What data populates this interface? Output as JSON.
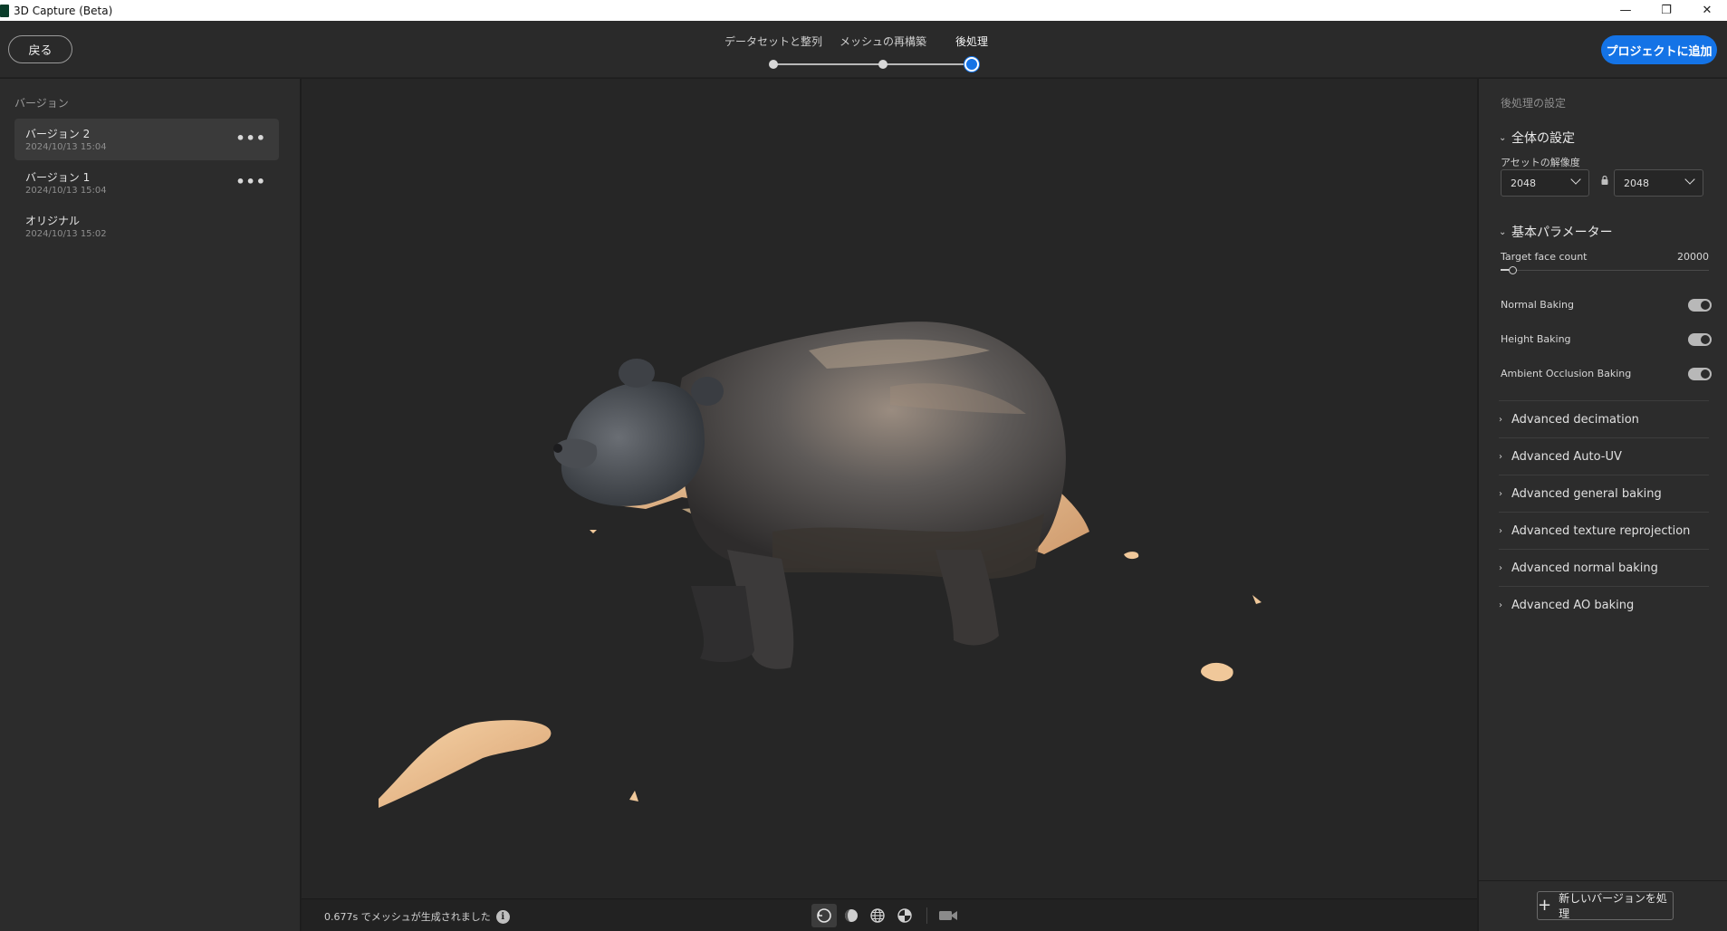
{
  "window": {
    "title": "3D Capture (Beta)",
    "minimize_glyph": "—",
    "restore_glyph": "❐",
    "close_glyph": "✕"
  },
  "header": {
    "back_label": "戻る",
    "steps": [
      {
        "label": "データセットと整列",
        "state": "done"
      },
      {
        "label": "メッシュの再構築",
        "state": "done"
      },
      {
        "label": "後処理",
        "state": "active"
      }
    ],
    "primary_label": "プロジェクトに追加"
  },
  "versions_panel": {
    "heading": "バージョン",
    "items": [
      {
        "name": "バージョン 2",
        "date": "2024/10/13 15:04",
        "more": "•••",
        "selected": true
      },
      {
        "name": "バージョン 1",
        "date": "2024/10/13 15:04",
        "more": "•••",
        "selected": false
      },
      {
        "name": "オリジナル",
        "date": "2024/10/13 15:02",
        "more": "",
        "selected": false
      }
    ]
  },
  "status_bar": {
    "message": "0.677s でメッシュが生成されました",
    "info_glyph": "i",
    "tools": [
      "orbit-icon",
      "shaded-sphere-icon",
      "wireframe-globe-icon",
      "texture-globe-icon",
      "camera-icon"
    ]
  },
  "settings": {
    "title": "後処理の設定",
    "global_section": "全体の設定",
    "resolution_label": "アセットの解像度",
    "resolution_width": "2048",
    "resolution_height": "2048",
    "params_section": "基本パラメーター",
    "target_face_label": "Target face count",
    "target_face_value": "20000",
    "target_face_fraction": 0.04,
    "toggles": [
      {
        "label": "Normal Baking",
        "on": true
      },
      {
        "label": "Height Baking",
        "on": true
      },
      {
        "label": "Ambient Occlusion Baking",
        "on": true
      }
    ],
    "advanced": [
      "Advanced decimation",
      "Advanced Auto-UV",
      "Advanced general baking",
      "Advanced texture reprojection",
      "Advanced normal baking",
      "Advanced AO baking"
    ],
    "new_version_label": "新しいバージョンを処理"
  },
  "colors": {
    "accent": "#1473e6",
    "panel_bg": "#2c2c2c",
    "viewport_bg": "#262626"
  }
}
